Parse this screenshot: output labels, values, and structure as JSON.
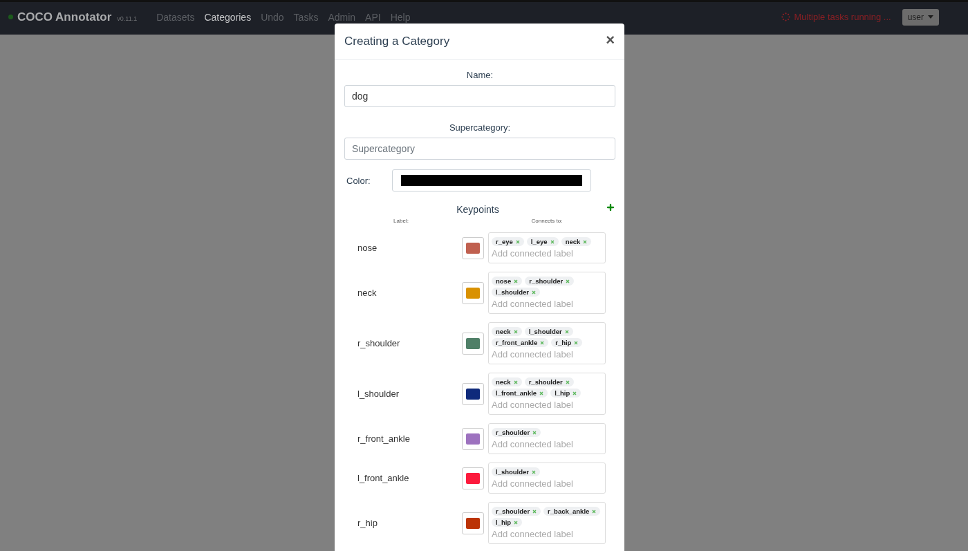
{
  "navbar": {
    "brand": "COCO Annotator",
    "version": "v0.11.1",
    "links": [
      {
        "label": "Datasets",
        "selected": false
      },
      {
        "label": "Categories",
        "selected": true
      },
      {
        "label": "Undo",
        "selected": false
      },
      {
        "label": "Tasks",
        "selected": false
      },
      {
        "label": "Admin",
        "selected": false
      },
      {
        "label": "API",
        "selected": false
      },
      {
        "label": "Help",
        "selected": false
      }
    ],
    "status": "Multiple tasks running ...",
    "user_menu": "user"
  },
  "modal": {
    "title": "Creating a Category",
    "close": "×",
    "fields": [
      {
        "label": "Name:",
        "value": "dog"
      },
      {
        "label": "Supercategory:",
        "placeholder": "Supercategory"
      }
    ],
    "color": {
      "label": "Color:",
      "color": "#000000"
    },
    "keypoints": {
      "title": "Keypoints",
      "label_heading": "Label:",
      "connects_heading": "Connects to:",
      "items": [
        {
          "label": "nose",
          "color": "#c0604f",
          "connections": [
            "r_eye",
            "l_eye",
            "neck"
          ],
          "placeholder": "Add connected label"
        },
        {
          "label": "neck",
          "color": "#d99100",
          "connections": [
            "nose",
            "r_shoulder",
            "l_shoulder"
          ],
          "placeholder": "Add connected label"
        },
        {
          "label": "r_shoulder",
          "color": "#4f7f67",
          "connections": [
            "neck",
            "l_shoulder",
            "r_front_ankle",
            "r_hip"
          ],
          "placeholder": "Add connected label"
        },
        {
          "label": "l_shoulder",
          "color": "#0f2a7b",
          "connections": [
            "neck",
            "r_shoulder",
            "l_front_ankle",
            "l_hip"
          ],
          "placeholder": "Add connected label"
        },
        {
          "label": "r_front_ankle",
          "color": "#9d72bf",
          "connections": [
            "r_shoulder"
          ],
          "placeholder": "Add connected label"
        },
        {
          "label": "l_front_ankle",
          "color": "#fc1a3c",
          "connections": [
            "l_shoulder"
          ],
          "placeholder": "Add connected label"
        },
        {
          "label": "r_hip",
          "color": "#bb3305",
          "connections": [
            "r_shoulder",
            "r_back_ankle",
            "l_hip"
          ],
          "placeholder": "Add connected label"
        }
      ]
    }
  }
}
